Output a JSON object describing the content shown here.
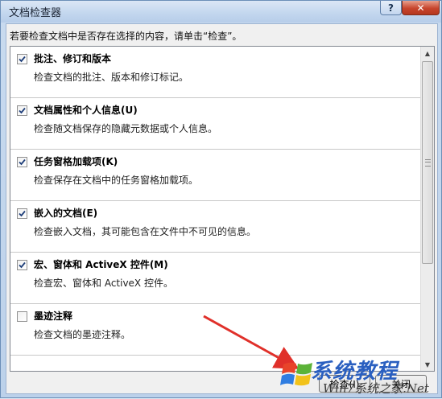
{
  "window": {
    "title": "文档检查器",
    "help_label": "?",
    "close_label": "✕"
  },
  "instruction": "若要检查文档中是否存在选择的内容，请单击“检查”。",
  "items": [
    {
      "title": "批注、修订和版本",
      "desc": "检查文档的批注、版本和修订标记。",
      "checked": true
    },
    {
      "title": "文档属性和个人信息(U)",
      "desc": "检查随文档保存的隐藏元数据或个人信息。",
      "checked": true
    },
    {
      "title": "任务窗格加载项(K)",
      "desc": "检查保存在文档中的任务窗格加载项。",
      "checked": true
    },
    {
      "title": "嵌入的文档(E)",
      "desc": "检查嵌入文档，其可能包含在文件中不可见的信息。",
      "checked": true
    },
    {
      "title": "宏、窗体和 ActiveX 控件(M)",
      "desc": "检查宏、窗体和 ActiveX 控件。",
      "checked": true
    },
    {
      "title": "墨迹注释",
      "desc": "检查文档的墨迹注释。",
      "checked": false
    }
  ],
  "buttons": {
    "inspect": "检查(I)",
    "close": "关闭"
  },
  "watermark": {
    "main": "系统教程",
    "sub": "Win7系统之家.Net"
  },
  "colors": {
    "arrow": "#e0302a",
    "accent": "#2a5fc0"
  }
}
